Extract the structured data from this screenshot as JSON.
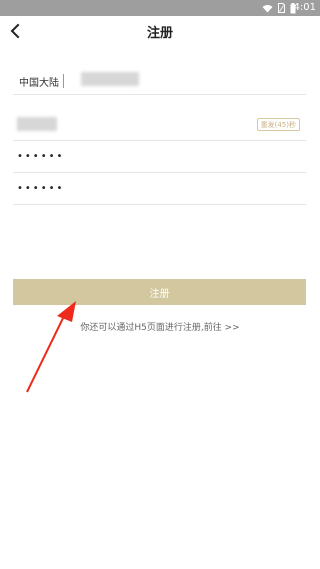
{
  "status_bar": {
    "time": "4:01",
    "icons": [
      "wifi-icon",
      "sim-icon",
      "battery-icon"
    ],
    "background": "#9e9e9e"
  },
  "header": {
    "title": "注册",
    "back_icon": "chevron-left-icon"
  },
  "form": {
    "phone": {
      "region": "中国大陆",
      "value_blurred": true
    },
    "verification_code": {
      "value_blurred": true,
      "resend_label": "重发(45)秒"
    },
    "password": {
      "value": "••••••"
    },
    "confirm_password": {
      "value": "••••••"
    }
  },
  "register_button": {
    "label": "注册",
    "color": "#d2c79e"
  },
  "h5_link": {
    "text": "你还可以通过H5页面进行注册,前往 >>"
  },
  "annotation": {
    "arrow_color": "#f02a1a",
    "arrow_icon": "red-arrow-icon"
  }
}
